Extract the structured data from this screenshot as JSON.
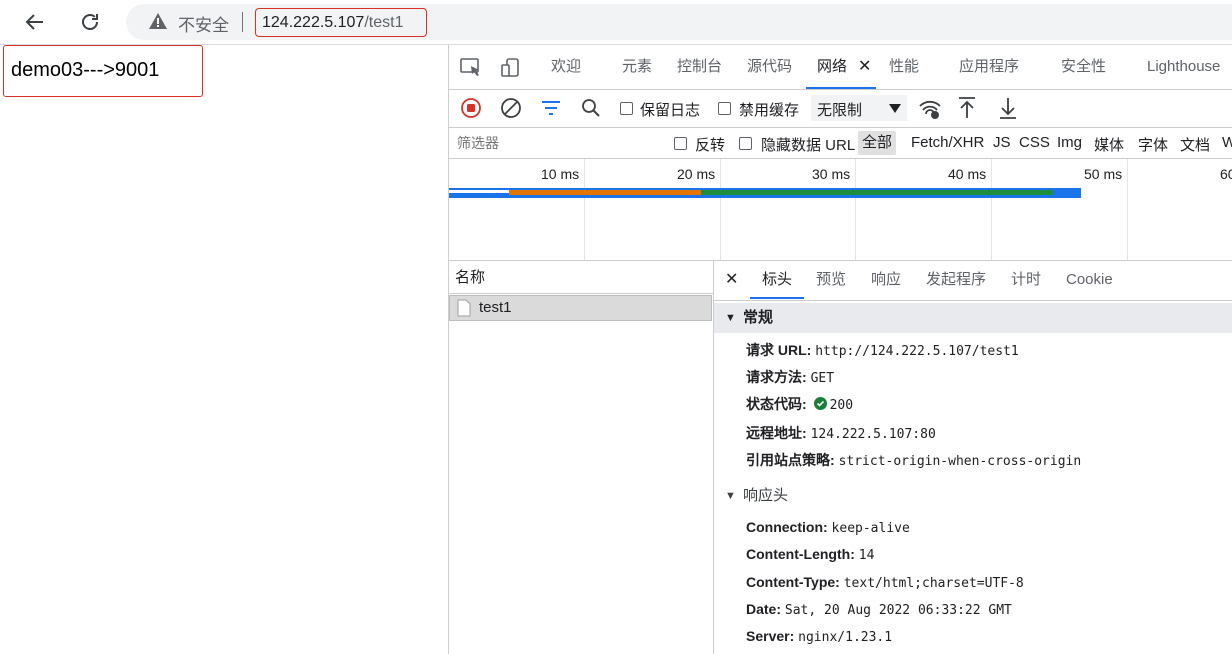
{
  "browser": {
    "security_label": "不安全",
    "url_host": "124.222.5.107",
    "url_path": "/test1"
  },
  "page": {
    "content": "demo03--->9001"
  },
  "devtools": {
    "tabs": [
      "欢迎",
      "元素",
      "控制台",
      "源代码",
      "网络",
      "性能",
      "应用程序",
      "安全性",
      "Lighthouse"
    ],
    "toolbar": {
      "preserve_log": "保留日志",
      "disable_cache": "禁用缓存",
      "throttle": "无限制"
    },
    "filter": {
      "placeholder": "筛选器",
      "invert": "反转",
      "hide_data_url": "隐藏数据 URL",
      "types": [
        "全部",
        "Fetch/XHR",
        "JS",
        "CSS",
        "Img",
        "媒体",
        "字体",
        "文档",
        "W"
      ]
    },
    "timeline": {
      "ticks": [
        "10 ms",
        "20 ms",
        "30 ms",
        "40 ms",
        "50 ms",
        "60"
      ]
    },
    "list": {
      "header": "名称",
      "rows": [
        "test1"
      ]
    },
    "detail": {
      "tabs": [
        "标头",
        "预览",
        "响应",
        "发起程序",
        "计时",
        "Cookie"
      ],
      "general_title": "常规",
      "general": [
        {
          "k": "请求 URL:",
          "v": "http://124.222.5.107/test1"
        },
        {
          "k": "请求方法:",
          "v": "GET"
        },
        {
          "k": "状态代码:",
          "v": "200"
        },
        {
          "k": "远程地址:",
          "v": "124.222.5.107:80"
        },
        {
          "k": "引用站点策略:",
          "v": "strict-origin-when-cross-origin"
        }
      ],
      "response_title": "响应头",
      "response": [
        {
          "k": "Connection:",
          "v": "keep-alive"
        },
        {
          "k": "Content-Length:",
          "v": "14"
        },
        {
          "k": "Content-Type:",
          "v": "text/html;charset=UTF-8"
        },
        {
          "k": "Date:",
          "v": "Sat, 20 Aug 2022 06:33:22 GMT"
        },
        {
          "k": "Server:",
          "v": "nginx/1.23.1"
        }
      ]
    }
  },
  "colors": {
    "accent": "#1a73e8",
    "record": "#d93025",
    "status_ok": "#188038"
  }
}
